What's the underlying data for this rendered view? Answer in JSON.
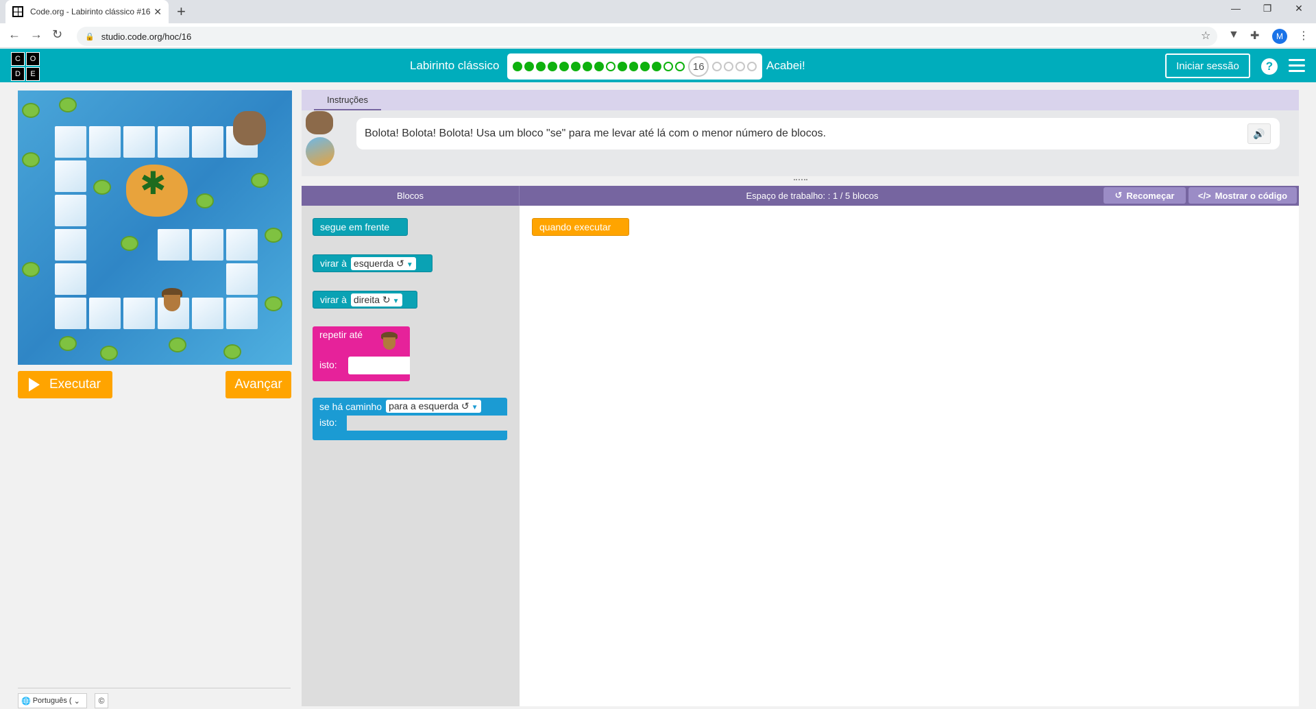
{
  "browser": {
    "tab_title": "Code.org - Labirinto clássico #16",
    "url": "studio.code.org/hoc/16",
    "avatar_initial": "M"
  },
  "header": {
    "logo_letters": [
      "C",
      "O",
      "D",
      "E"
    ],
    "level_title": "Labirinto clássico",
    "current_level": "16",
    "done_label": "Acabei!",
    "signin_label": "Iniciar sessão",
    "help_label": "?",
    "progress": {
      "completed": 15,
      "current": 16,
      "total": 20
    }
  },
  "game": {
    "run_label": "Executar",
    "advance_label": "Avançar"
  },
  "instructions": {
    "tab_label": "Instruções",
    "text": "Bolota! Bolota! Bolota! Usa um bloco \"se\" para me levar até lá com o menor número de blocos."
  },
  "workspace": {
    "blocks_header": "Blocos",
    "title": "Espaço de trabalho: : 1 / 5 blocos",
    "restart_label": "Recomeçar",
    "show_code_label": "Mostrar o código",
    "toolbox": {
      "move_forward": "segue em frente",
      "turn_left": "virar à",
      "turn_left_dd": "esquerda ↺",
      "turn_right": "virar à",
      "turn_right_dd": "direita ↻",
      "repeat_until": "repetir até",
      "repeat_do": "isto:",
      "if_path": "se há caminho",
      "if_path_dd": "para a esquerda ↺",
      "if_do": "isto:"
    },
    "when_run": "quando executar"
  },
  "footer": {
    "language": "Português (",
    "copyright": "©"
  },
  "colors": {
    "brand_teal": "#00adbc",
    "run_orange": "#ffa400",
    "workspace_purple": "#7665a0",
    "block_teal": "#0aa2b4",
    "block_pink": "#e6229a",
    "block_blue": "#1b9bd3"
  }
}
